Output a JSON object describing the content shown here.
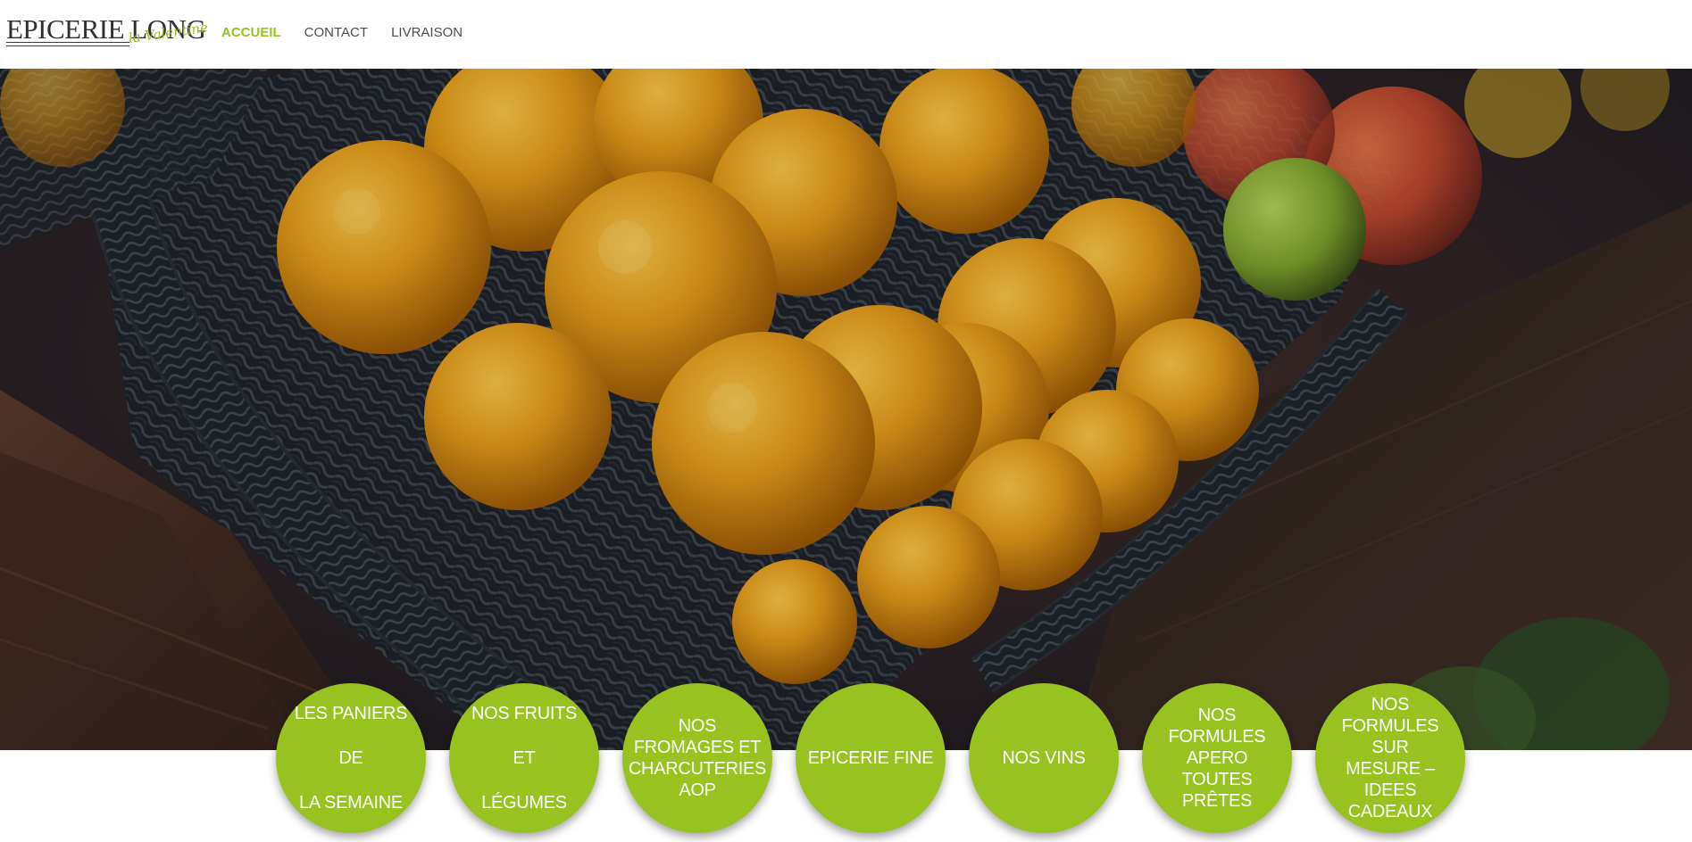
{
  "header": {
    "logo": {
      "main": "EPICERIE LONG",
      "script": "la Valentine"
    },
    "nav": [
      {
        "label": "ACCUEIL"
      },
      {
        "label": "CONTACT"
      },
      {
        "label": "LIVRAISON"
      }
    ]
  },
  "hero": {
    "image_description": "Close-up of a black wicker basket full of oranges, with red and green fruit in the background"
  },
  "categories": [
    {
      "label": "LES PANIERS DE\nLA SEMAINE"
    },
    {
      "label": "NOS FRUITS ET\nLÉGUMES"
    },
    {
      "label": "NOS\nFROMAGES ET\nCHARCUTERIES\nAOP"
    },
    {
      "label": "EPICERIE FINE"
    },
    {
      "label": "NOS VINS"
    },
    {
      "label": "NOS\nFORMULES\nAPERO TOUTES\nPRÊTES"
    },
    {
      "label": "NOS\nFORMULES SUR\nMESURE –\nIDEES CADEAUX"
    }
  ],
  "colors": {
    "accent": "#98c21f",
    "nav_text": "#4c4c4c",
    "white": "#ffffff"
  }
}
